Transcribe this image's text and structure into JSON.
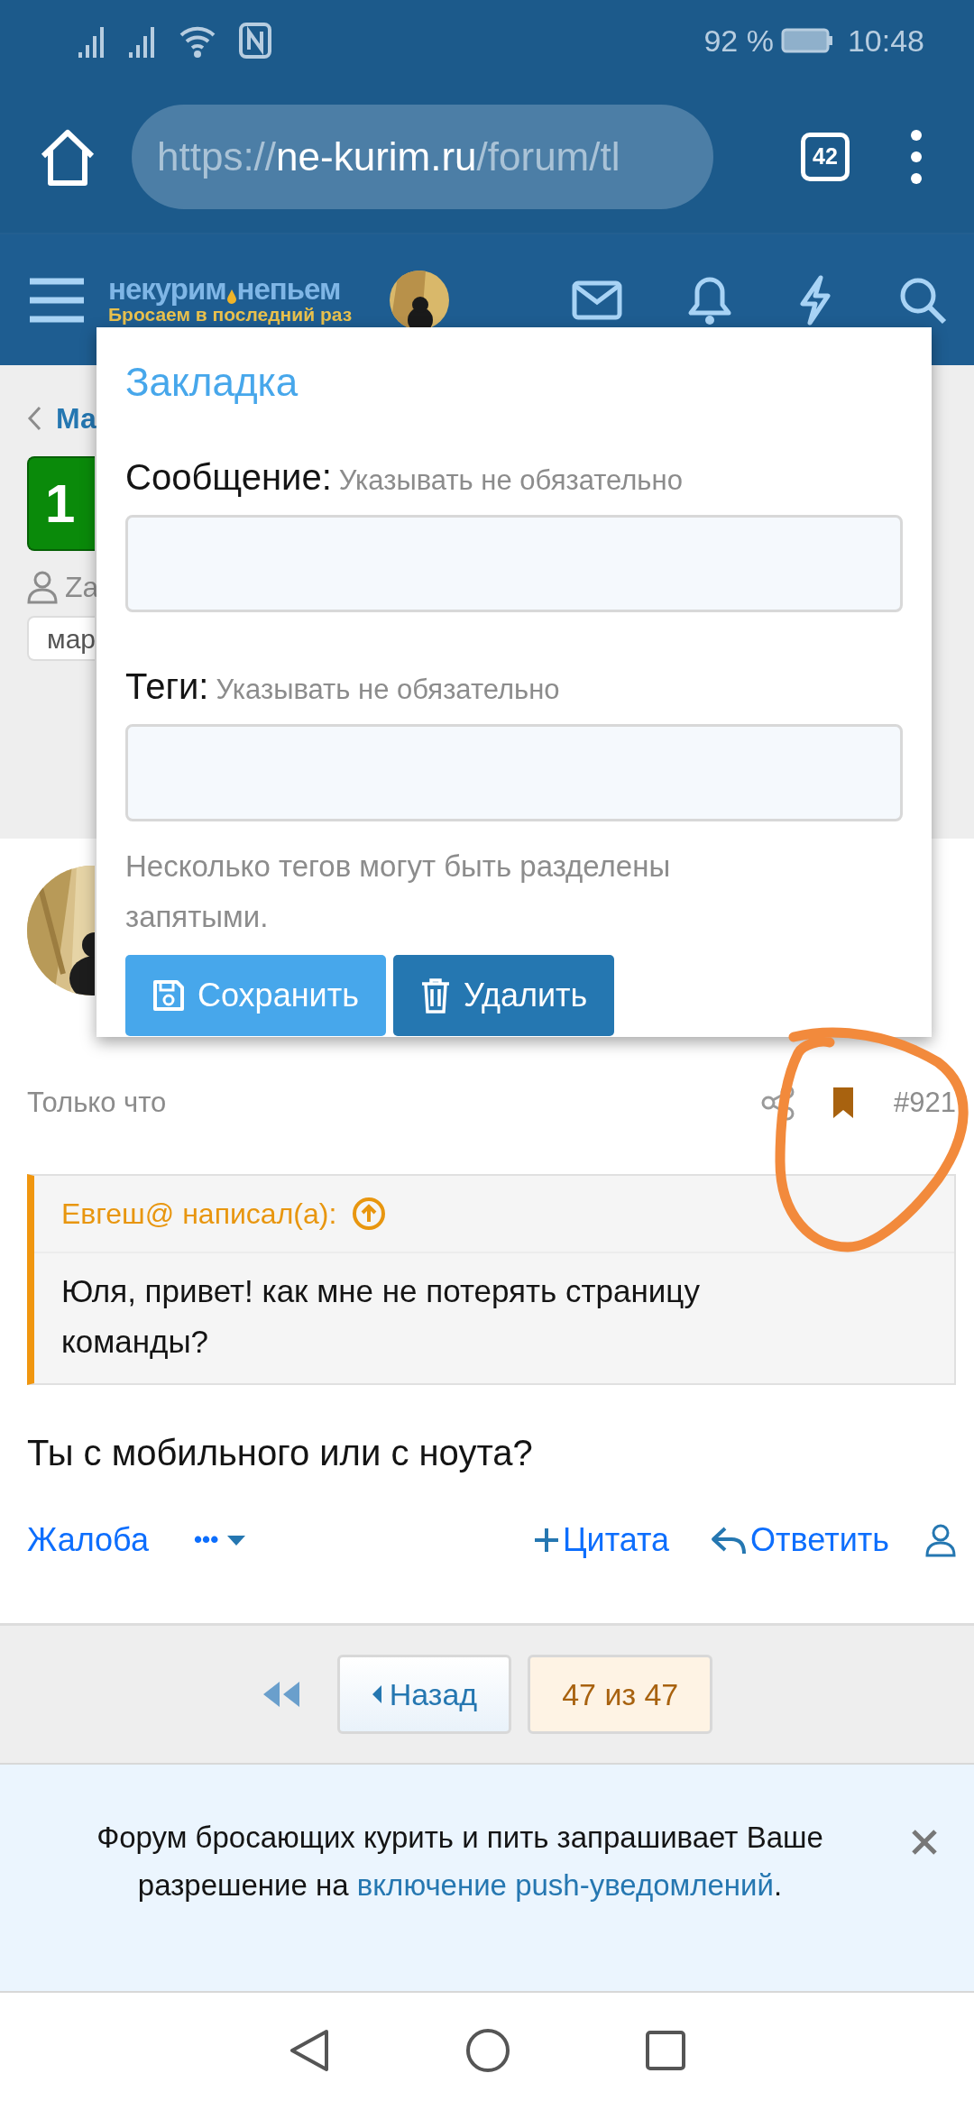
{
  "status_bar": {
    "battery": "92 %",
    "time": "10:48"
  },
  "browser": {
    "url": {
      "scheme": "https://",
      "host": "ne-kurim.ru",
      "path": "/forum/tl"
    },
    "tab_count": "42"
  },
  "forum_header": {
    "logo_title_left": "некурим",
    "logo_title_right": "непьем",
    "logo_tagline": "Бросаем в последний раз"
  },
  "thread": {
    "breadcrumb": "Ма",
    "badge": "1",
    "author": "Za",
    "tag": "мар"
  },
  "bookmark_popup": {
    "title": "Закладка",
    "fields": [
      {
        "label": "Сообщение:",
        "hint": "Указывать не обязательно"
      },
      {
        "label": "Теги:",
        "hint": "Указывать не обязательно"
      }
    ],
    "explanation": "Несколько тегов могут быть разделены запятыми.",
    "buttons": [
      {
        "kind": "save",
        "label": "Сохранить"
      },
      {
        "kind": "delete",
        "label": "Удалить"
      }
    ]
  },
  "post": {
    "time": "Только что",
    "bookmarked": true,
    "number": "#921",
    "quote": {
      "author": "Евгеш@ написал(а):",
      "text": "Юля, привет! как мне не потерять страницу команды?"
    },
    "text": "Ты с мобильного или с ноута?",
    "actions": {
      "report": "Жалоба",
      "more": "•••",
      "quote": "Цитата",
      "reply": "Ответить"
    }
  },
  "pagination": {
    "prev": "Назад",
    "current": "47 из 47"
  },
  "notice": {
    "text_before": "Форум бросающих курить и пить запрашивает Ваше разрешение на ",
    "link": "включение push-уведомлений",
    "text_after": "."
  }
}
